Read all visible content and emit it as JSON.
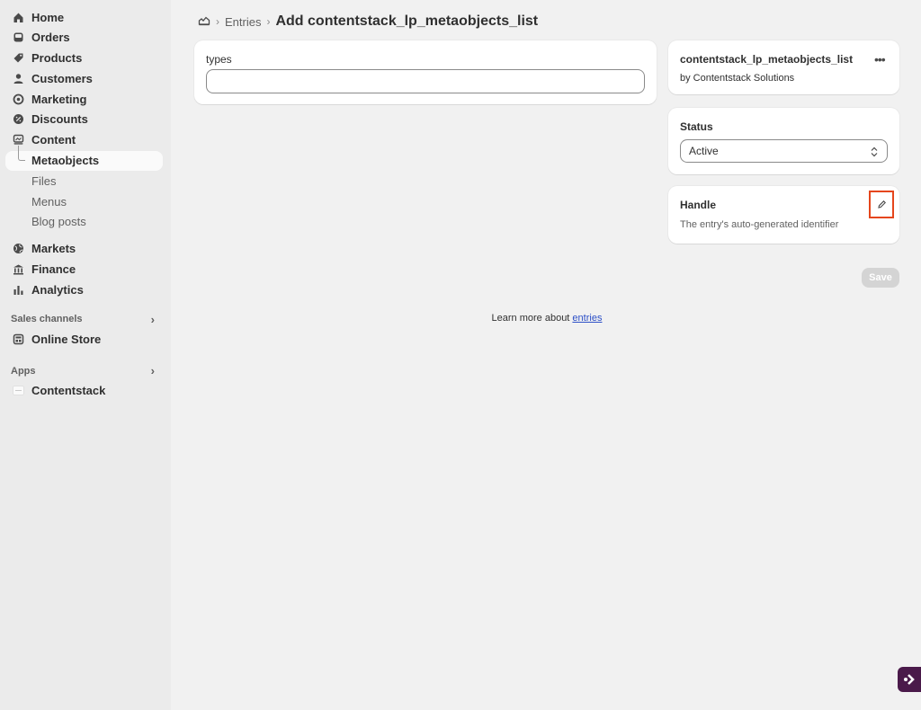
{
  "sidebar": {
    "items": [
      {
        "label": "Home",
        "icon": "home-icon"
      },
      {
        "label": "Orders",
        "icon": "inbox-icon"
      },
      {
        "label": "Products",
        "icon": "tag-icon"
      },
      {
        "label": "Customers",
        "icon": "person-icon"
      },
      {
        "label": "Marketing",
        "icon": "target-icon"
      },
      {
        "label": "Discounts",
        "icon": "discount-icon"
      },
      {
        "label": "Content",
        "icon": "content-icon"
      }
    ],
    "content_sub": [
      "Metaobjects",
      "Files",
      "Menus",
      "Blog posts"
    ],
    "items2": [
      {
        "label": "Markets",
        "icon": "globe-icon"
      },
      {
        "label": "Finance",
        "icon": "bank-icon"
      },
      {
        "label": "Analytics",
        "icon": "bar-chart-icon"
      }
    ],
    "sales_channels_header": "Sales channels",
    "online_store": "Online Store",
    "apps_header": "Apps",
    "contentstack": "Contentstack"
  },
  "breadcrumb": {
    "section": "Entries",
    "title": "Add contentstack_lp_metaobjects_list"
  },
  "types_card": {
    "label": "types",
    "value": ""
  },
  "definition_card": {
    "name": "contentstack_lp_metaobjects_list",
    "by": "by Contentstack Solutions"
  },
  "status_card": {
    "label": "Status",
    "selected": "Active"
  },
  "handle_card": {
    "label": "Handle",
    "description": "The entry's auto-generated identifier"
  },
  "save_label": "Save",
  "learn_more": {
    "prefix": "Learn more about ",
    "link": "entries"
  },
  "colors": {
    "highlight": "#e5461c",
    "link": "#2c4fc7",
    "badge": "#4a1a4a"
  }
}
